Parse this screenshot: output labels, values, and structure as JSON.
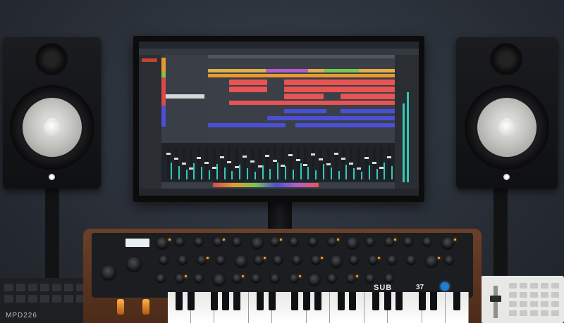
{
  "synth": {
    "brand_left": "SUB",
    "model_number": "37"
  },
  "drum_pad": {
    "brand": "MPD226"
  },
  "colors": {
    "wall": "#2c323b",
    "synth_wood": "#6b4028",
    "daw_accent_red": "#e85454",
    "daw_accent_blue": "#4b4fd6",
    "daw_accent_orange": "#e79a30",
    "meter_cyan": "#31c9b7",
    "key_light_amber": "#ffa63a"
  },
  "icons": [
    "studio-monitor-speaker",
    "computer-monitor",
    "daw-software-window",
    "analog-synthesizer",
    "drum-pad-controller",
    "midi-controller"
  ]
}
